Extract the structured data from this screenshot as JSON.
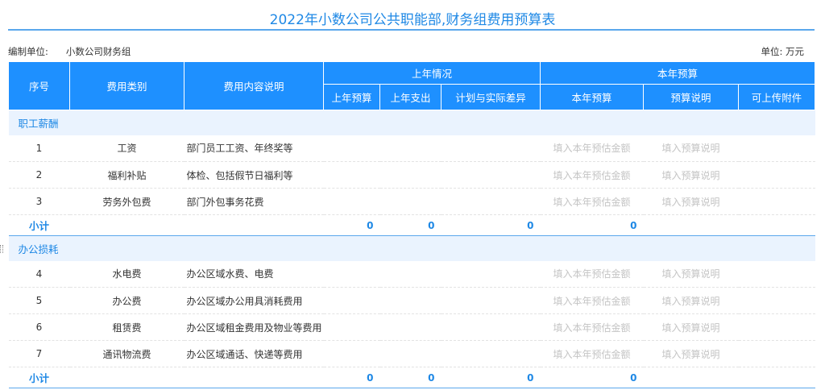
{
  "title": "2022年小数公司公共职能部,财务组费用预算表",
  "meta": {
    "org_label": "编制单位:",
    "org_value": "小数公司财务组",
    "unit": "单位: 万元"
  },
  "header": {
    "col_seq": "序号",
    "col_category": "费用类别",
    "col_desc": "费用内容说明",
    "group_last_year": "上年情况",
    "group_this_year": "本年预算",
    "col_last_budget": "上年预算",
    "col_last_spend": "上年支出",
    "col_diff": "计划与实际差异",
    "col_this_budget": "本年预算",
    "col_budget_note": "预算说明",
    "col_attachment": "可上传附件"
  },
  "placeholders": {
    "amount": "填入本年预估金额",
    "note": "填入预算说明"
  },
  "groups": [
    {
      "name": "职工薪酬",
      "rows": [
        {
          "seq": "1",
          "category": "工资",
          "desc": "部门员工工资、年终奖等"
        },
        {
          "seq": "2",
          "category": "福利补贴",
          "desc": "体检、包括假节日福利等"
        },
        {
          "seq": "3",
          "category": "劳务外包费",
          "desc": "部门外包事务花费"
        }
      ],
      "subtotal": {
        "label": "小计",
        "last_budget": "0",
        "last_spend": "0",
        "diff": "0",
        "this_budget": "0"
      }
    },
    {
      "name": "办公损耗",
      "rows": [
        {
          "seq": "4",
          "category": "水电费",
          "desc": "办公区域水费、电费"
        },
        {
          "seq": "5",
          "category": "办公费",
          "desc": "办公区域办公用具消耗费用"
        },
        {
          "seq": "6",
          "category": "租赁费",
          "desc": "办公区域租金费用及物业等费用"
        },
        {
          "seq": "7",
          "category": "通讯物流费",
          "desc": "办公区域通话、快递等费用"
        }
      ],
      "subtotal": {
        "label": "小计",
        "last_budget": "0",
        "last_spend": "0",
        "diff": "0",
        "this_budget": "0"
      }
    }
  ]
}
